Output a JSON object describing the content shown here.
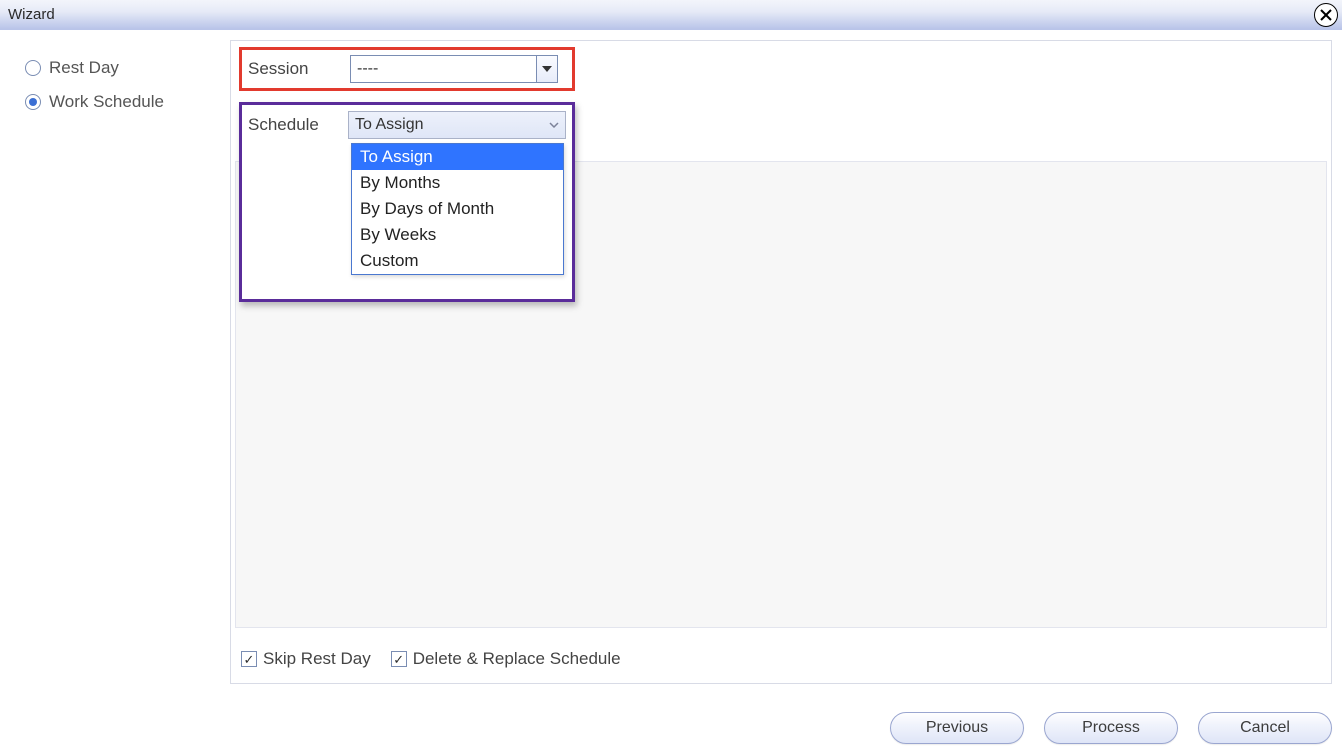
{
  "window": {
    "title": "Wizard"
  },
  "radios": {
    "rest_day": "Rest Day",
    "work_schedule": "Work Schedule",
    "selected": "work_schedule"
  },
  "session": {
    "label": "Session",
    "value": "----"
  },
  "schedule": {
    "label": "Schedule",
    "value": "To Assign",
    "options": [
      "To Assign",
      "By Months",
      "By Days of Month",
      "By Weeks",
      "Custom"
    ],
    "highlighted": "To Assign"
  },
  "checkboxes": {
    "skip_rest_day": {
      "label": "Skip Rest Day",
      "checked": true
    },
    "delete_replace": {
      "label": "Delete & Replace Schedule",
      "checked": true
    }
  },
  "buttons": {
    "previous": "Previous",
    "process": "Process",
    "cancel": "Cancel"
  }
}
